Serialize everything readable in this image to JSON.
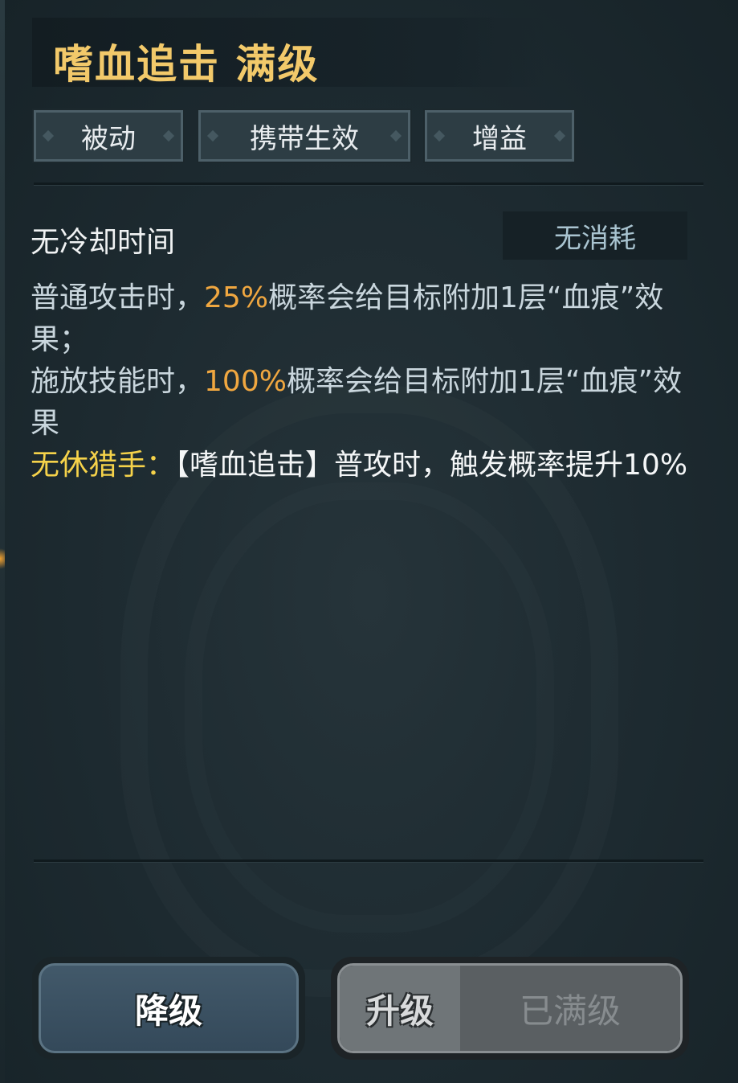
{
  "skill": {
    "title": "嗜血追击 满级"
  },
  "tags": [
    "被动",
    "携带生效",
    "增益"
  ],
  "info": {
    "cooldown": "无冷却时间",
    "cost": "无消耗"
  },
  "description": {
    "line1_pre": "普通攻击时，",
    "line1_pct": "25%",
    "line1_post": "概率会给目标附加1层“血痕”效果；",
    "line2_pre": "施放技能时，",
    "line2_pct": "100%",
    "line2_post": "概率会给目标附加1层“血痕”效果",
    "bonus_label": "无休猎手：",
    "bonus_text": "【嗜血追击】普攻时，触发概率提升10%"
  },
  "buttons": {
    "downgrade": "降级",
    "upgrade": "升级",
    "maxed": "已满级"
  },
  "colors": {
    "title": "#f2c96a",
    "highlight": "#f0a740",
    "bonus": "#f5d24a",
    "background": "#1e2a30"
  }
}
